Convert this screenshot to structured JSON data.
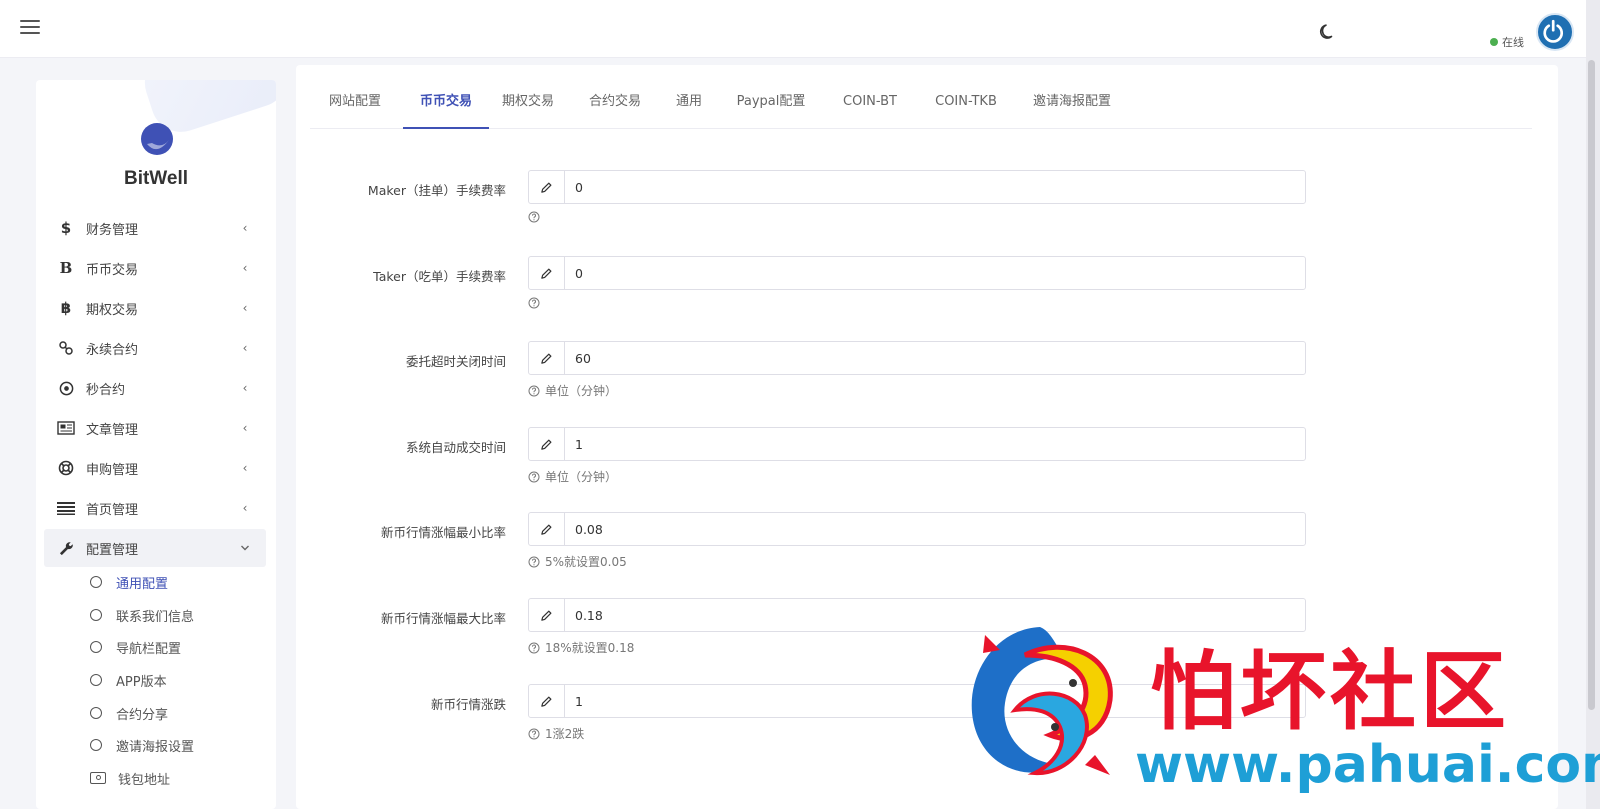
{
  "topbar": {
    "status_text": "在线",
    "status_color": "#4caf50",
    "menu_icon": "hamburger-icon",
    "theme_icon": "moon-icon",
    "avatar_icon": "power-icon"
  },
  "sidebar": {
    "brand": "BitWell",
    "logo_icon": "logo-icon",
    "items": [
      {
        "label": "财务管理",
        "icon": "dollar-icon"
      },
      {
        "label": "币币交易",
        "icon": "b-icon"
      },
      {
        "label": "期权交易",
        "icon": "bitcoin-icon"
      },
      {
        "label": "永续合约",
        "icon": "link-icon"
      },
      {
        "label": "秒合约",
        "icon": "target-icon"
      },
      {
        "label": "文章管理",
        "icon": "newspaper-icon"
      },
      {
        "label": "申购管理",
        "icon": "lifebuoy-icon"
      },
      {
        "label": "首页管理",
        "icon": "list-icon"
      },
      {
        "label": "配置管理",
        "icon": "wrench-icon"
      }
    ],
    "sub_items": [
      {
        "label": "通用配置",
        "active": true
      },
      {
        "label": "联系我们信息"
      },
      {
        "label": "导航栏配置"
      },
      {
        "label": "APP版本"
      },
      {
        "label": "合约分享"
      },
      {
        "label": "邀请海报设置"
      },
      {
        "label": "钱包地址"
      }
    ]
  },
  "tabs": [
    "网站配置",
    "币币交易",
    "期权交易",
    "合约交易",
    "通用",
    "Paypal配置",
    "COIN-BT",
    "COIN-TKB",
    "邀请海报配置"
  ],
  "active_tab": "币币交易",
  "accent_color": "#3f51b5",
  "form": [
    {
      "label": "Maker（挂单）手续费率",
      "value": "0",
      "help": ""
    },
    {
      "label": "Taker（吃单）手续费率",
      "value": "0",
      "help": ""
    },
    {
      "label": "委托超时关闭时间",
      "value": "60",
      "help": "单位（分钟）"
    },
    {
      "label": "系统自动成交时间",
      "value": "1",
      "help": "单位（分钟）"
    },
    {
      "label": "新币行情涨幅最小比率",
      "value": "0.08",
      "help": "5%就设置0.05"
    },
    {
      "label": "新币行情涨幅最大比率",
      "value": "0.18",
      "help": "18%就设置0.18"
    },
    {
      "label": "新币行情涨跌",
      "value": "1",
      "help": "1涨2跌"
    }
  ],
  "watermark": {
    "title": "怕坏社区",
    "url": "www.pahuai.com"
  }
}
